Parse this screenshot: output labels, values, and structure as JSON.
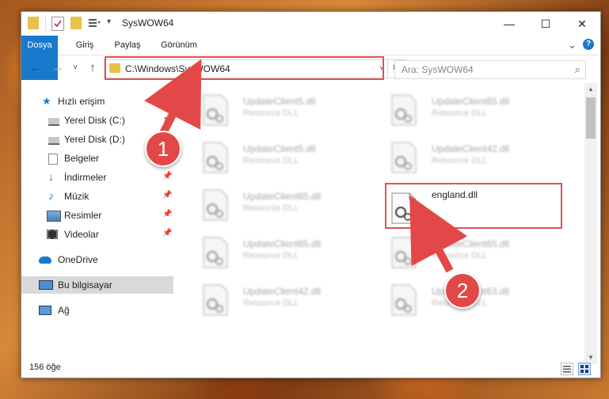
{
  "window": {
    "title": "SysWOW64",
    "minimize": "—",
    "maximize": "☐",
    "close": "✕"
  },
  "ribbon": {
    "tabs": [
      "Dosya",
      "Giriş",
      "Paylaş",
      "Görünüm"
    ],
    "collapse_icon": "chevron-down-icon",
    "help_icon": "help-icon"
  },
  "navigation": {
    "back": "←",
    "forward": "→",
    "recent": "˅",
    "up": "↑",
    "address": "C:\\Windows\\SysWOW64",
    "dropdown": "˅",
    "refresh": "↻",
    "search_placeholder": "Ara: SysWOW64",
    "search_icon": "⌕"
  },
  "sidebar": {
    "items": [
      {
        "label": "Hızlı erişim",
        "icon": "star-icon"
      },
      {
        "label": "Yerel Disk (C:)",
        "icon": "drive-icon",
        "pinned": true
      },
      {
        "label": "Yerel Disk (D:)",
        "icon": "drive-icon",
        "pinned": false
      },
      {
        "label": "Belgeler",
        "icon": "documents-icon",
        "pinned": true
      },
      {
        "label": "İndirmeler",
        "icon": "download-icon",
        "pinned": true
      },
      {
        "label": "Müzik",
        "icon": "music-icon",
        "pinned": true
      },
      {
        "label": "Resimler",
        "icon": "pictures-icon",
        "pinned": true
      },
      {
        "label": "Videolar",
        "icon": "videos-icon",
        "pinned": true
      },
      {
        "label": "OneDrive",
        "icon": "cloud-icon"
      },
      {
        "label": "Bu bilgisayar",
        "icon": "computer-icon",
        "selected": true
      },
      {
        "label": "Ağ",
        "icon": "network-icon"
      }
    ]
  },
  "files": [
    {
      "name": "UpdateClient5.dll",
      "type": "Resource DLL"
    },
    {
      "name": "UpdateClient65.dll",
      "type": "Resource DLL"
    },
    {
      "name": "UpdateClient5.dll",
      "type": "Resource DLL"
    },
    {
      "name": "UpdateClient42.dll",
      "type": "Resource DLL"
    },
    {
      "name": "UpdateClient65.dll",
      "type": "Resource DLL"
    },
    {
      "name": "england.dll",
      "type": ""
    },
    {
      "name": "UpdateClient65.dll",
      "type": "Resource DLL"
    },
    {
      "name": "UpdateClient65.dll",
      "type": "Resource DLL"
    },
    {
      "name": "UpdateClient42.dll",
      "type": "Resource DLL"
    },
    {
      "name": "UpdateClient63.dll",
      "type": "Resource DLL"
    }
  ],
  "status": {
    "count": "156 öğe"
  },
  "annotations": {
    "badge1": "1",
    "badge2": "2",
    "color": "#e05252"
  }
}
